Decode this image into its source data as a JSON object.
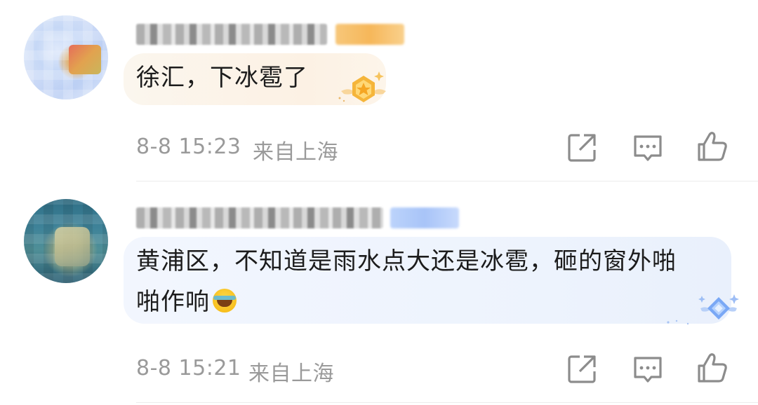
{
  "comments": [
    {
      "text": "徐汇，下冰雹了",
      "date": "8-8 15:23",
      "location": "来自上海",
      "bubble_theme": "gold",
      "icons": [
        "share-icon",
        "reply-icon",
        "like-icon"
      ]
    },
    {
      "text_line1": "黄浦区，不知道是雨水点大还是冰雹，砸的窗外啪",
      "text_line2": "啪作响",
      "emoji": "laugh-cry-emoji",
      "date": "8-8 15:21",
      "location": "来自上海",
      "bubble_theme": "blue",
      "icons": [
        "share-icon",
        "reply-icon",
        "like-icon"
      ]
    }
  ],
  "colors": {
    "meta_text": "#9a9a9a",
    "comment_text": "#1c1c1c",
    "icon_stroke": "#8c8c8c",
    "gold_bubble": "#fcf1e4",
    "blue_bubble": "#edf3fd"
  }
}
